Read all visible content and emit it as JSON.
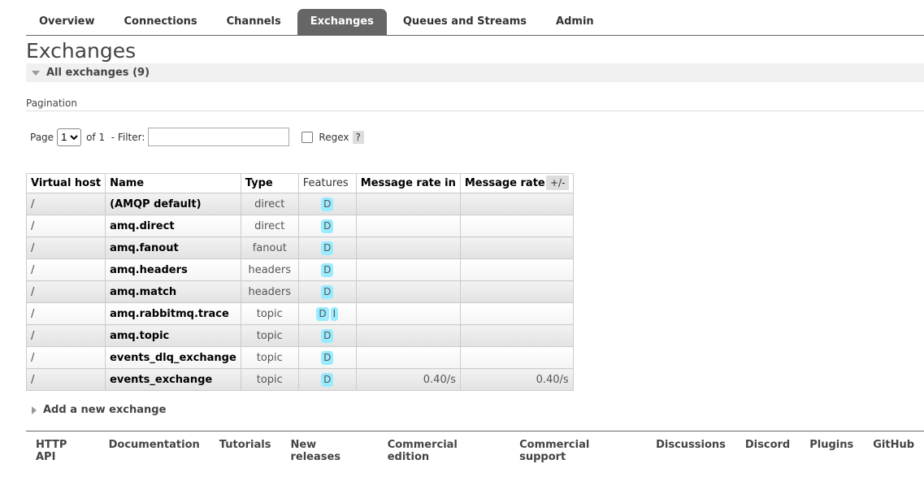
{
  "tabs": [
    "Overview",
    "Connections",
    "Channels",
    "Exchanges",
    "Queues and Streams",
    "Admin"
  ],
  "title": "Exchanges",
  "section": "All exchanges (9)",
  "pagination": {
    "title": "Pagination",
    "page_label": "Page",
    "page_value": "1",
    "of_label": "of 1",
    "filter_label": "- Filter:",
    "filter_value": "",
    "regex_label": "Regex",
    "help": "?"
  },
  "table": {
    "headers": [
      "Virtual host",
      "Name",
      "Type",
      "Features",
      "Message rate in",
      "Message rate out"
    ],
    "toggle": "+/-",
    "rows": [
      {
        "vhost": "/",
        "name": "(AMQP default)",
        "type": "direct",
        "features": [
          "D"
        ],
        "rate_in": "",
        "rate_out": ""
      },
      {
        "vhost": "/",
        "name": "amq.direct",
        "type": "direct",
        "features": [
          "D"
        ],
        "rate_in": "",
        "rate_out": ""
      },
      {
        "vhost": "/",
        "name": "amq.fanout",
        "type": "fanout",
        "features": [
          "D"
        ],
        "rate_in": "",
        "rate_out": ""
      },
      {
        "vhost": "/",
        "name": "amq.headers",
        "type": "headers",
        "features": [
          "D"
        ],
        "rate_in": "",
        "rate_out": ""
      },
      {
        "vhost": "/",
        "name": "amq.match",
        "type": "headers",
        "features": [
          "D"
        ],
        "rate_in": "",
        "rate_out": ""
      },
      {
        "vhost": "/",
        "name": "amq.rabbitmq.trace",
        "type": "topic",
        "features": [
          "D",
          "I"
        ],
        "rate_in": "",
        "rate_out": ""
      },
      {
        "vhost": "/",
        "name": "amq.topic",
        "type": "topic",
        "features": [
          "D"
        ],
        "rate_in": "",
        "rate_out": ""
      },
      {
        "vhost": "/",
        "name": "events_dlq_exchange",
        "type": "topic",
        "features": [
          "D"
        ],
        "rate_in": "",
        "rate_out": ""
      },
      {
        "vhost": "/",
        "name": "events_exchange",
        "type": "topic",
        "features": [
          "D"
        ],
        "rate_in": "0.40/s",
        "rate_out": "0.40/s"
      }
    ]
  },
  "add_exchange": "Add a new exchange",
  "footer": [
    "HTTP API",
    "Documentation",
    "Tutorials",
    "New releases",
    "Commercial edition",
    "Commercial support",
    "Discussions",
    "Discord",
    "Plugins",
    "GitHub"
  ]
}
